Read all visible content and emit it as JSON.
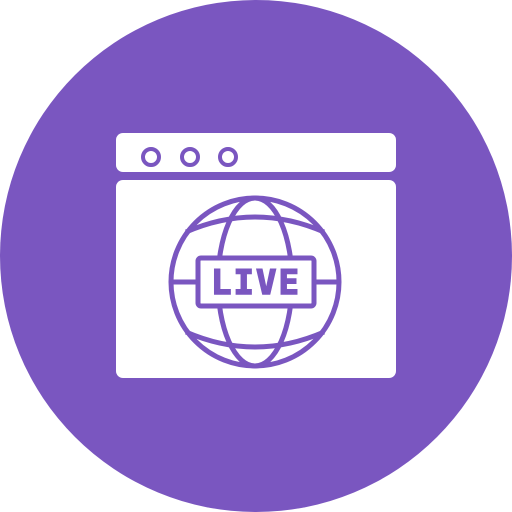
{
  "icon": {
    "name": "live-stream-browser-icon",
    "badge_text": "LIVE",
    "colors": {
      "circle": "#7A56C0",
      "foreground": "#FFFFFF"
    },
    "parts": [
      "browser-window-icon",
      "window-dots-icon",
      "globe-icon",
      "live-badge"
    ]
  }
}
